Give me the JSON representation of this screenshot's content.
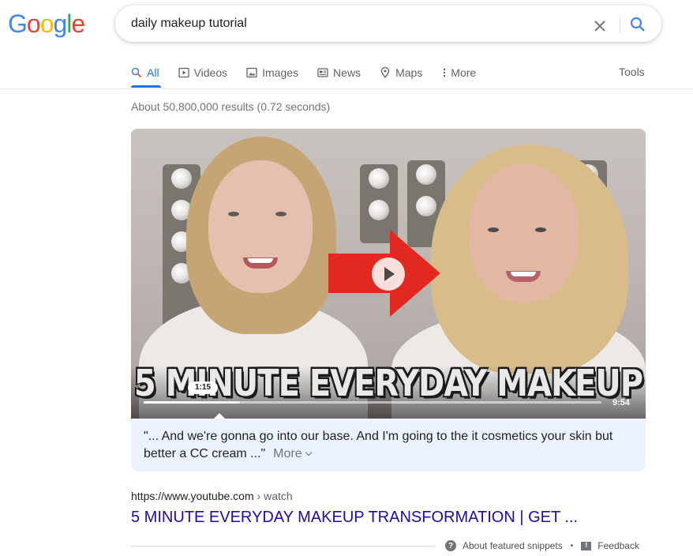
{
  "logo": {
    "text": "Google",
    "letters": [
      {
        "ch": "G",
        "color": "#4285F4"
      },
      {
        "ch": "o",
        "color": "#EA4335"
      },
      {
        "ch": "o",
        "color": "#FBBC05"
      },
      {
        "ch": "g",
        "color": "#4285F4"
      },
      {
        "ch": "l",
        "color": "#34A853"
      },
      {
        "ch": "e",
        "color": "#EA4335"
      }
    ]
  },
  "search": {
    "query": "daily makeup tutorial",
    "clear_icon": "close-icon",
    "search_icon": "search-icon"
  },
  "tabs": [
    {
      "label": "All",
      "icon": "search-icon",
      "active": true
    },
    {
      "label": "Videos",
      "icon": "play-icon"
    },
    {
      "label": "Images",
      "icon": "image-icon"
    },
    {
      "label": "News",
      "icon": "news-icon"
    },
    {
      "label": "Maps",
      "icon": "map-pin-icon"
    },
    {
      "label": "More",
      "icon": "more-vertical-icon"
    }
  ],
  "tools_label": "Tools",
  "stats": "About 50,800,000 results (0.72 seconds)",
  "video": {
    "caption": "5 MINUTE EVERYDAY MAKEUP",
    "seek_time": "1:15",
    "duration": "9:54",
    "progress_fraction": 0.126,
    "buffered_fraction": 0.21
  },
  "snippet": {
    "text": "\"... And we're gonna go into our base. And I'm going to the it cosmetics your skin but better a CC cream ...\"",
    "more_label": "More"
  },
  "result": {
    "url": "https://www.youtube.com",
    "breadcrumb": " › watch",
    "title": "5 MINUTE EVERYDAY MAKEUP TRANSFORMATION | GET ..."
  },
  "footer": {
    "about_label": "About featured snippets",
    "separator": "•",
    "feedback_label": "Feedback"
  },
  "colors": {
    "accent": "#1a73e8",
    "link": "#1a0dab",
    "snippet_bg": "#edf3fe",
    "arrow": "#e1291f"
  }
}
